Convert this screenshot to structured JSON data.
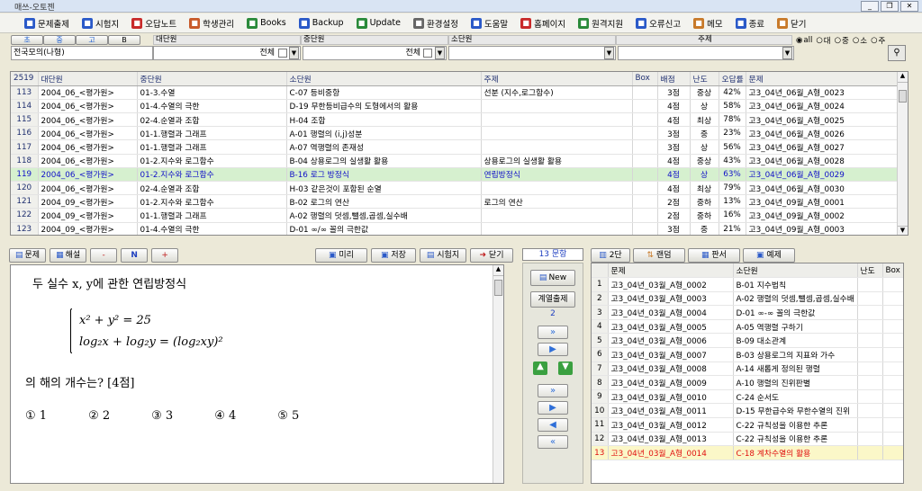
{
  "window": {
    "title": "매쓰-오토젠",
    "buttons": [
      "_",
      "❐",
      "✕"
    ]
  },
  "toolbar": [
    {
      "label": "문제출제",
      "icon": "sigma-icon",
      "color": "#2a59c8"
    },
    {
      "label": "시험지",
      "icon": "sigma-icon",
      "color": "#2a59c8"
    },
    {
      "label": "오답노트",
      "icon": "sigma-icon",
      "color": "#c82a2a"
    },
    {
      "label": "학생관리",
      "icon": "person-icon",
      "color": "#c85a2a"
    },
    {
      "label": "Books",
      "icon": "books-icon",
      "color": "#2a8a3a"
    },
    {
      "label": "Backup",
      "icon": "backup-icon",
      "color": "#2a59c8"
    },
    {
      "label": "Update",
      "icon": "download-icon",
      "color": "#2a8a3a"
    },
    {
      "label": "환경설정",
      "icon": "gear-icon",
      "color": "#666666"
    },
    {
      "label": "도움말",
      "icon": "help-icon",
      "color": "#2a59c8"
    },
    {
      "label": "홈페이지",
      "icon": "home-icon",
      "color": "#c82a2a"
    },
    {
      "label": "원격지원",
      "icon": "remote-icon",
      "color": "#2a8a3a"
    },
    {
      "label": "오류신고",
      "icon": "report-icon",
      "color": "#2a59c8"
    },
    {
      "label": "메모",
      "icon": "memo-icon",
      "color": "#c87a2a"
    },
    {
      "label": "종료",
      "icon": "exit-icon",
      "color": "#2a59c8"
    },
    {
      "label": "닫기",
      "icon": "close-icon",
      "color": "#c87a2a"
    }
  ],
  "filter": {
    "level_tabs": [
      "초",
      "중",
      "고",
      "B"
    ],
    "headers": {
      "dae": "대단원",
      "jung": "중단원",
      "so": "소단원",
      "ju": "주제"
    },
    "values": {
      "region": "전국모의(나형)",
      "all1": "전체",
      "all2": "전체"
    },
    "radios": [
      "all",
      "대",
      "중",
      "소",
      "주"
    ],
    "selected_radio": "all"
  },
  "grid": {
    "count": "2519",
    "columns": [
      "대단원",
      "중단원",
      "소단원",
      "주제",
      "Box",
      "배점",
      "난도",
      "오답률",
      "문제"
    ],
    "rows": [
      [
        "113",
        "2004_06_<평가원>",
        "01-3.수열",
        "C-07 등비중항",
        "선분 (지수,로그함수)",
        "",
        "3점",
        "중상",
        "42%",
        "고3_04년_06월_A형_0023"
      ],
      [
        "114",
        "2004_06_<평가원>",
        "01-4.수열의 극한",
        "D-19 무한등비급수의 도형에서의 활용",
        "",
        "",
        "4점",
        "상",
        "58%",
        "고3_04년_06월_A형_0024"
      ],
      [
        "115",
        "2004_06_<평가원>",
        "02-4.순열과 조합",
        "H-04 조합",
        "",
        "",
        "4점",
        "최상",
        "78%",
        "고3_04년_06월_A형_0025"
      ],
      [
        "116",
        "2004_06_<평가원>",
        "01-1.행렬과 그래프",
        "A-01 행렬의 (i,j)성분",
        "",
        "",
        "3점",
        "중",
        "23%",
        "고3_04년_06월_A형_0026"
      ],
      [
        "117",
        "2004_06_<평가원>",
        "01-1.행렬과 그래프",
        "A-07 역행렬의 존재성",
        "",
        "",
        "3점",
        "상",
        "56%",
        "고3_04년_06월_A형_0027"
      ],
      [
        "118",
        "2004_06_<평가원>",
        "01-2.지수와 로그함수",
        "B-04 상용로그의 실생활 활용",
        "상용로그의 실생활 활용",
        "",
        "4점",
        "중상",
        "43%",
        "고3_04년_06월_A형_0028"
      ],
      [
        "119",
        "2004_06_<평가원>",
        "01-2.지수와 로그함수",
        "B-16 로그 방정식",
        "연립방정식",
        "",
        "4점",
        "상",
        "63%",
        "고3_04년_06월_A형_0029"
      ],
      [
        "120",
        "2004_06_<평가원>",
        "02-4.순열과 조합",
        "H-03 같은것이 포함된 순열",
        "",
        "",
        "4점",
        "최상",
        "79%",
        "고3_04년_06월_A형_0030"
      ],
      [
        "121",
        "2004_09_<평가원>",
        "01-2.지수와 로그함수",
        "B-02 로그의 연산",
        "로그의 연산",
        "",
        "2점",
        "중하",
        "13%",
        "고3_04년_09월_A형_0001"
      ],
      [
        "122",
        "2004_09_<평가원>",
        "01-1.행렬과 그래프",
        "A-02 행렬의 덧셈,뺄셈,곱셈,실수배",
        "",
        "",
        "2점",
        "중하",
        "16%",
        "고3_04년_09월_A형_0002"
      ],
      [
        "123",
        "2004_09_<평가원>",
        "01-4.수열의 극한",
        "D-01 ∞/∞ 꼴의 극한값",
        "",
        "",
        "3점",
        "중",
        "21%",
        "고3_04년_09월_A형_0003"
      ]
    ],
    "selected": "119"
  },
  "question": {
    "tabs": [
      "문제",
      "해설"
    ],
    "small_btns": [
      "-",
      "N",
      "+"
    ],
    "actions": [
      "미리",
      "저장",
      "시험지",
      "닫기"
    ],
    "stem": "두 실수 x, y에 관한 연립방정식",
    "eq1": "x² + y² = 25",
    "eq2": "log₂x + log₂y = (log₂xy)²",
    "ask": "의 해의 개수는? [4점]",
    "choices": [
      "① 1",
      "② 2",
      "③ 3",
      "④ 4",
      "⑤ 5"
    ]
  },
  "middle": {
    "count": "13 문항",
    "new": "New",
    "sort": "계열출제",
    "num": "2"
  },
  "right": {
    "tabs": [
      "2단",
      "랜덤",
      "판서",
      "예제"
    ],
    "columns": [
      "문제",
      "소단원",
      "난도",
      "Box"
    ],
    "rows": [
      [
        "1",
        "고3_04년_03월_A형_0002",
        "B-01 지수법칙"
      ],
      [
        "2",
        "고3_04년_03월_A형_0003",
        "A-02 행렬의 덧셈,뺄셈,곱셈,실수배"
      ],
      [
        "3",
        "고3_04년_03월_A형_0004",
        "D-01 ∞-∞ 꼴의 극한값"
      ],
      [
        "4",
        "고3_04년_03월_A형_0005",
        "A-05 역행렬 구하기"
      ],
      [
        "5",
        "고3_04년_03월_A형_0006",
        "B-09 대소관계"
      ],
      [
        "6",
        "고3_04년_03월_A형_0007",
        "B-03 상용로그의 지표와 가수"
      ],
      [
        "7",
        "고3_04년_03월_A형_0008",
        "A-14 새롭게 정의된 행렬"
      ],
      [
        "8",
        "고3_04년_03월_A형_0009",
        "A-10 행렬의 진위판별"
      ],
      [
        "9",
        "고3_04년_03월_A형_0010",
        "C-24 순서도"
      ],
      [
        "10",
        "고3_04년_03월_A형_0011",
        "D-15 무한급수와 무한수열의 진위"
      ],
      [
        "11",
        "고3_04년_03월_A형_0012",
        "C-22 규칙성을 이용한 추론"
      ],
      [
        "12",
        "고3_04년_03월_A형_0013",
        "C-22 규칙성을 이용한 추론"
      ],
      [
        "13",
        "고3_04년_03월_A형_0014",
        "C-18 계차수열의 활용"
      ]
    ],
    "selected": "13"
  }
}
